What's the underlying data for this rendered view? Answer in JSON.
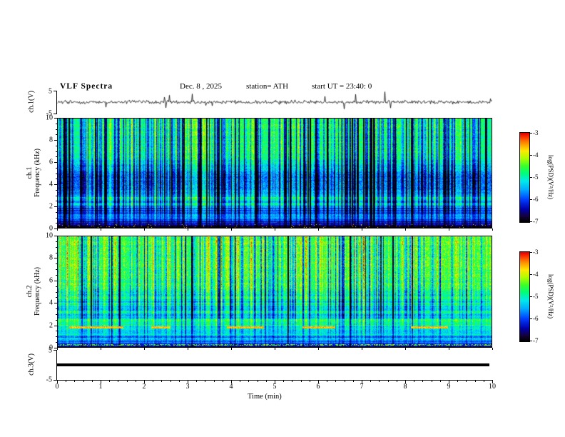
{
  "header": {
    "title": "VLF  Spectra",
    "date": "Dec. 8 , 2025",
    "station": "station= ATH",
    "start_ut": "start UT =  23:40: 0"
  },
  "xaxis": {
    "label": "Time  (min)",
    "ticks": [
      0,
      1,
      2,
      3,
      4,
      5,
      6,
      7,
      8,
      9,
      10
    ]
  },
  "panels": {
    "ch1_wave": {
      "ylabel": "ch.1(V)",
      "yticks": [
        5,
        -5
      ]
    },
    "ch1_spec": {
      "ylabel_line1": "ch.1",
      "ylabel_line2": "Frequency  (kHz)",
      "yticks": [
        10,
        8,
        6,
        4,
        2,
        0
      ]
    },
    "ch2_spec": {
      "ylabel_line1": "ch.2",
      "ylabel_line2": "Frequency  (kHz)",
      "yticks": [
        10,
        8,
        6,
        4,
        2,
        0
      ]
    },
    "ch3_wave": {
      "ylabel": "ch.3(V)",
      "yticks": [
        5,
        -5
      ]
    }
  },
  "colorbar": {
    "label": "log(PSD)(V²/Hz)",
    "ticks": [
      -3,
      -4,
      -5,
      -6,
      -7
    ],
    "range": [
      -7,
      -3
    ]
  },
  "chart_data": [
    {
      "type": "line",
      "panel": "ch1_waveform",
      "ylabel": "ch.1(V)",
      "ylim": [
        -5,
        5
      ],
      "yticks": [
        5,
        -5
      ],
      "xlim": [
        0,
        10
      ],
      "description": "Broadband VLF time series: low-amplitude noise near 0 V with frequent impulsive sferic spikes reaching roughly ±2 to ±5 V across the full 10 minutes"
    },
    {
      "type": "heatmap",
      "panel": "ch1_spectrogram",
      "ylabel": "ch.1 Frequency (kHz)",
      "ylim": [
        0,
        10
      ],
      "yticks": [
        0,
        2,
        4,
        6,
        8,
        10
      ],
      "xlim": [
        0,
        10
      ],
      "colorbar_label": "log(PSD)(V²/Hz)",
      "colorbar_range": [
        -7,
        -3
      ],
      "colorbar_ticks": [
        -3,
        -4,
        -5,
        -6,
        -7
      ],
      "bands": [
        {
          "freq_khz": "6-10",
          "psd": "about -4.5 (green) with dense dark-blue vertical sferic streaks"
        },
        {
          "freq_khz": "3-6",
          "psd": "about -5.5 to -6 (blue band), blotchy navy patches"
        },
        {
          "freq_khz": "1-3",
          "psd": "horizontally striped cyan/green and blue rows"
        },
        {
          "freq_khz": "0-1",
          "psd": "about -6.5 to -7 (dark/black) with sparse colored specks"
        }
      ]
    },
    {
      "type": "heatmap",
      "panel": "ch2_spectrogram",
      "ylabel": "ch.2 Frequency (kHz)",
      "ylim": [
        0,
        10
      ],
      "yticks": [
        0,
        2,
        4,
        6,
        8,
        10
      ],
      "xlim": [
        0,
        10
      ],
      "colorbar_label": "log(PSD)(V²/Hz)",
      "colorbar_range": [
        -7,
        -3
      ],
      "colorbar_ticks": [
        -3,
        -4,
        -5,
        -6,
        -7
      ],
      "bands": [
        {
          "freq_khz": "5-10",
          "psd": "about -4.2 (green/yellow) with bright yellow vertical streaks"
        },
        {
          "freq_khz": "2-5",
          "psd": "alternating green/cyan and darker horizontal stripes"
        },
        {
          "freq_khz": "1.7-1.9",
          "psd": "intermittent red/orange high-PSD line segments (near -3.2)"
        },
        {
          "freq_khz": "0-1",
          "psd": "darker blue/black with a reddish row near the bottom"
        }
      ]
    },
    {
      "type": "line",
      "panel": "ch3_waveform",
      "ylabel": "ch.3(V)",
      "ylim": [
        -5,
        5
      ],
      "yticks": [
        5,
        -5
      ],
      "xlim": [
        0,
        10
      ],
      "description": "Flat constant trace at approximately 0 V (thick black line, no signal)"
    }
  ]
}
